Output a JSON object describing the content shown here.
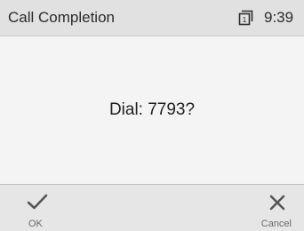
{
  "header": {
    "title": "Call Completion",
    "line_indicator": "1",
    "time": "9:39"
  },
  "main": {
    "prompt": "Dial: 7793?"
  },
  "softkeys": {
    "ok": {
      "label": "OK",
      "icon": "check-icon"
    },
    "cancel": {
      "label": "Cancel",
      "icon": "close-icon"
    }
  }
}
